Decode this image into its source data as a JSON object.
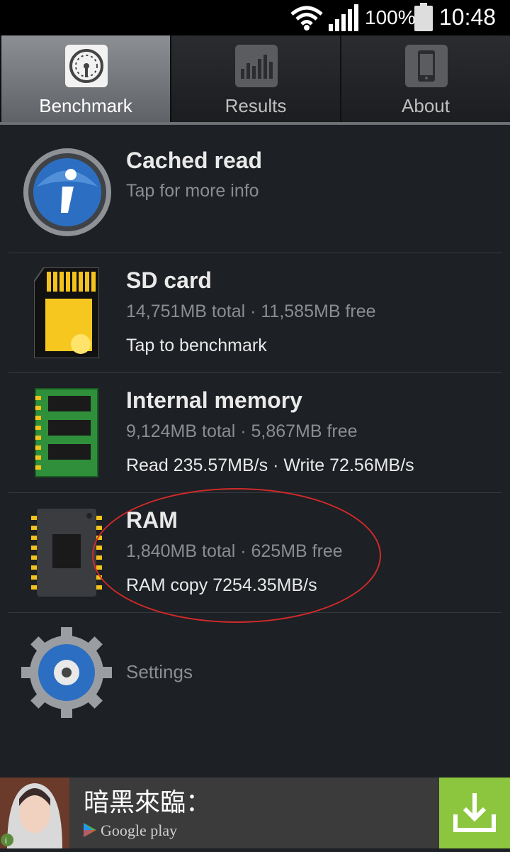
{
  "status_bar": {
    "battery_percent": "100%",
    "time": "10:48",
    "icons": [
      "wifi-icon",
      "signal-icon",
      "battery-icon"
    ]
  },
  "tabs": [
    {
      "label": "Benchmark",
      "icon": "speedometer-icon",
      "selected": true
    },
    {
      "label": "Results",
      "icon": "bar-chart-icon",
      "selected": false
    },
    {
      "label": "About",
      "icon": "phone-icon",
      "selected": false
    }
  ],
  "items": {
    "cached_read": {
      "title": "Cached read",
      "subtitle": "Tap for more info",
      "icon": "info-icon"
    },
    "sd_card": {
      "title": "SD card",
      "subtitle": "14,751MB total · 11,585MB free",
      "detail": "Tap to benchmark",
      "icon": "sd-card-icon"
    },
    "internal_memory": {
      "title": "Internal memory",
      "subtitle": "9,124MB total · 5,867MB free",
      "detail": "Read 235.57MB/s · Write 72.56MB/s",
      "icon": "memory-chip-icon"
    },
    "ram": {
      "title": "RAM",
      "subtitle": "1,840MB total · 625MB free",
      "detail": "RAM copy 7254.35MB/s",
      "icon": "ram-chip-icon"
    },
    "settings": {
      "label": "Settings",
      "icon": "gear-icon"
    }
  },
  "ad": {
    "title": "暗黑來臨：",
    "store_label": "Google play",
    "icons": [
      "ad-thumbnail",
      "google-play-icon",
      "download-icon"
    ],
    "button_color": "#8cc63f"
  },
  "colors": {
    "background": "#1d2024",
    "annotation": "#d22a2a"
  }
}
